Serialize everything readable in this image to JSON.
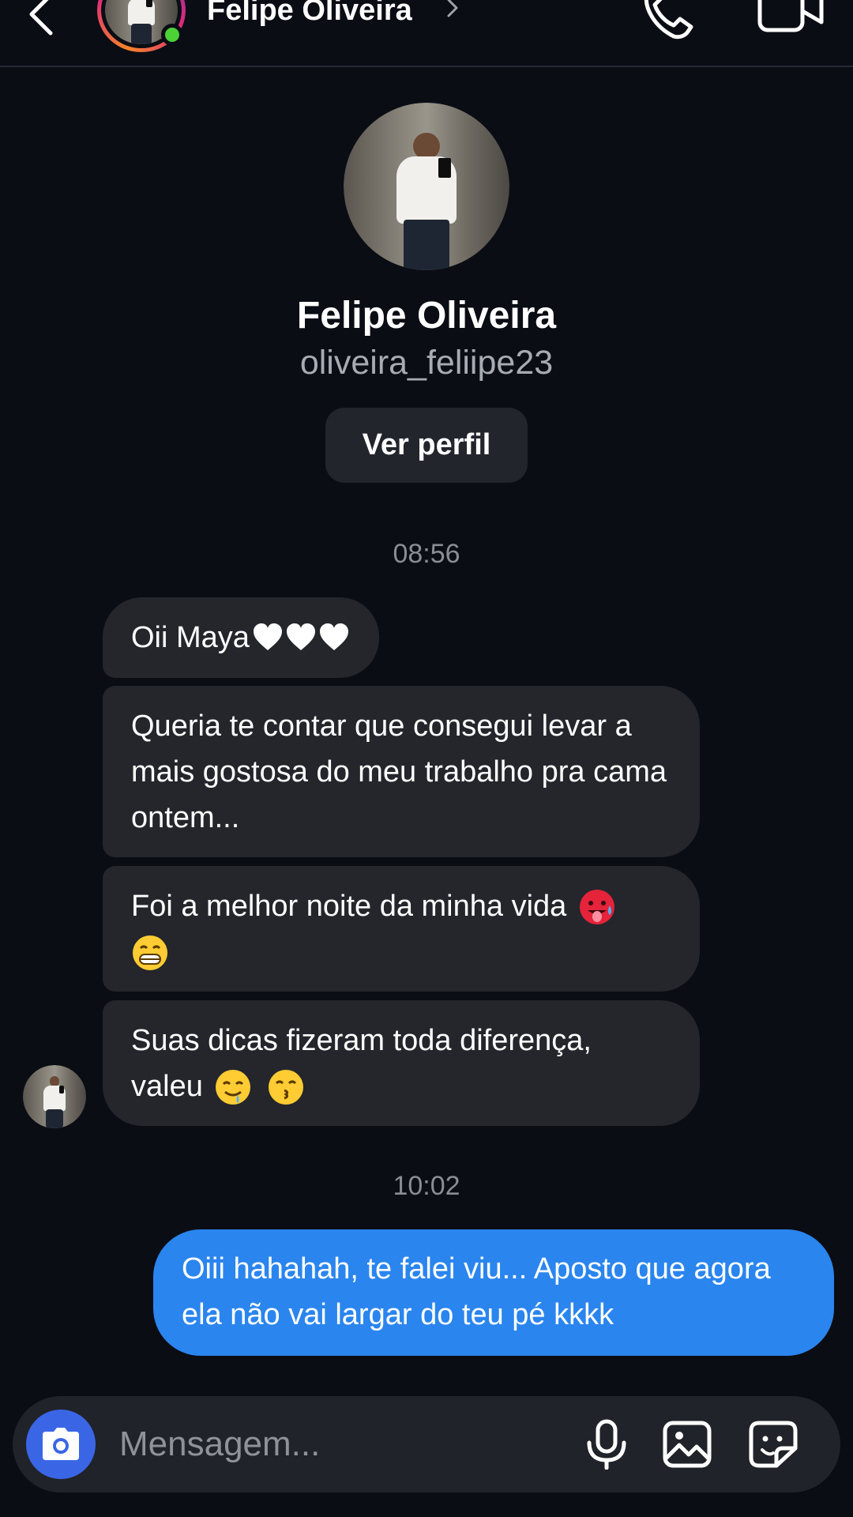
{
  "header": {
    "contact_name": "Felipe Oliveira",
    "back_icon": "chevron-left-icon",
    "call_icon": "phone-icon",
    "video_icon": "video-camera-icon",
    "online_color": "#4cd137"
  },
  "profile": {
    "name": "Felipe Oliveira",
    "username": "oliveira_feliipe23",
    "view_profile_label": "Ver perfil"
  },
  "messages": {
    "time_1": "08:56",
    "incoming": [
      {
        "text": "Oii Maya",
        "emoji": [
          "white-heart",
          "white-heart",
          "white-heart"
        ]
      },
      {
        "text": "Queria te contar que consegui levar a mais gostosa do meu trabalho pra cama ontem...",
        "emoji": []
      },
      {
        "text": "Foi a melhor noite da minha vida",
        "emoji": [
          "hot-face",
          "grinning-face"
        ]
      },
      {
        "text": "Suas dicas fizeram toda diferença, valeu",
        "emoji": [
          "drooling-face",
          "kissing-face"
        ]
      }
    ],
    "time_2": "10:02",
    "outgoing": [
      {
        "text": "Oiii hahahah, te falei viu... Aposto que agora ela não vai largar do teu pé kkkk"
      }
    ]
  },
  "composer": {
    "placeholder": "Mensagem...",
    "camera_icon": "camera-icon",
    "mic_icon": "microphone-icon",
    "gallery_icon": "image-icon",
    "sticker_icon": "sticker-icon"
  },
  "colors": {
    "background": "#0b0d14",
    "incoming_bubble": "#24262c",
    "outgoing_bubble": "#2a85ee",
    "camera_button": "#3a66e6"
  }
}
